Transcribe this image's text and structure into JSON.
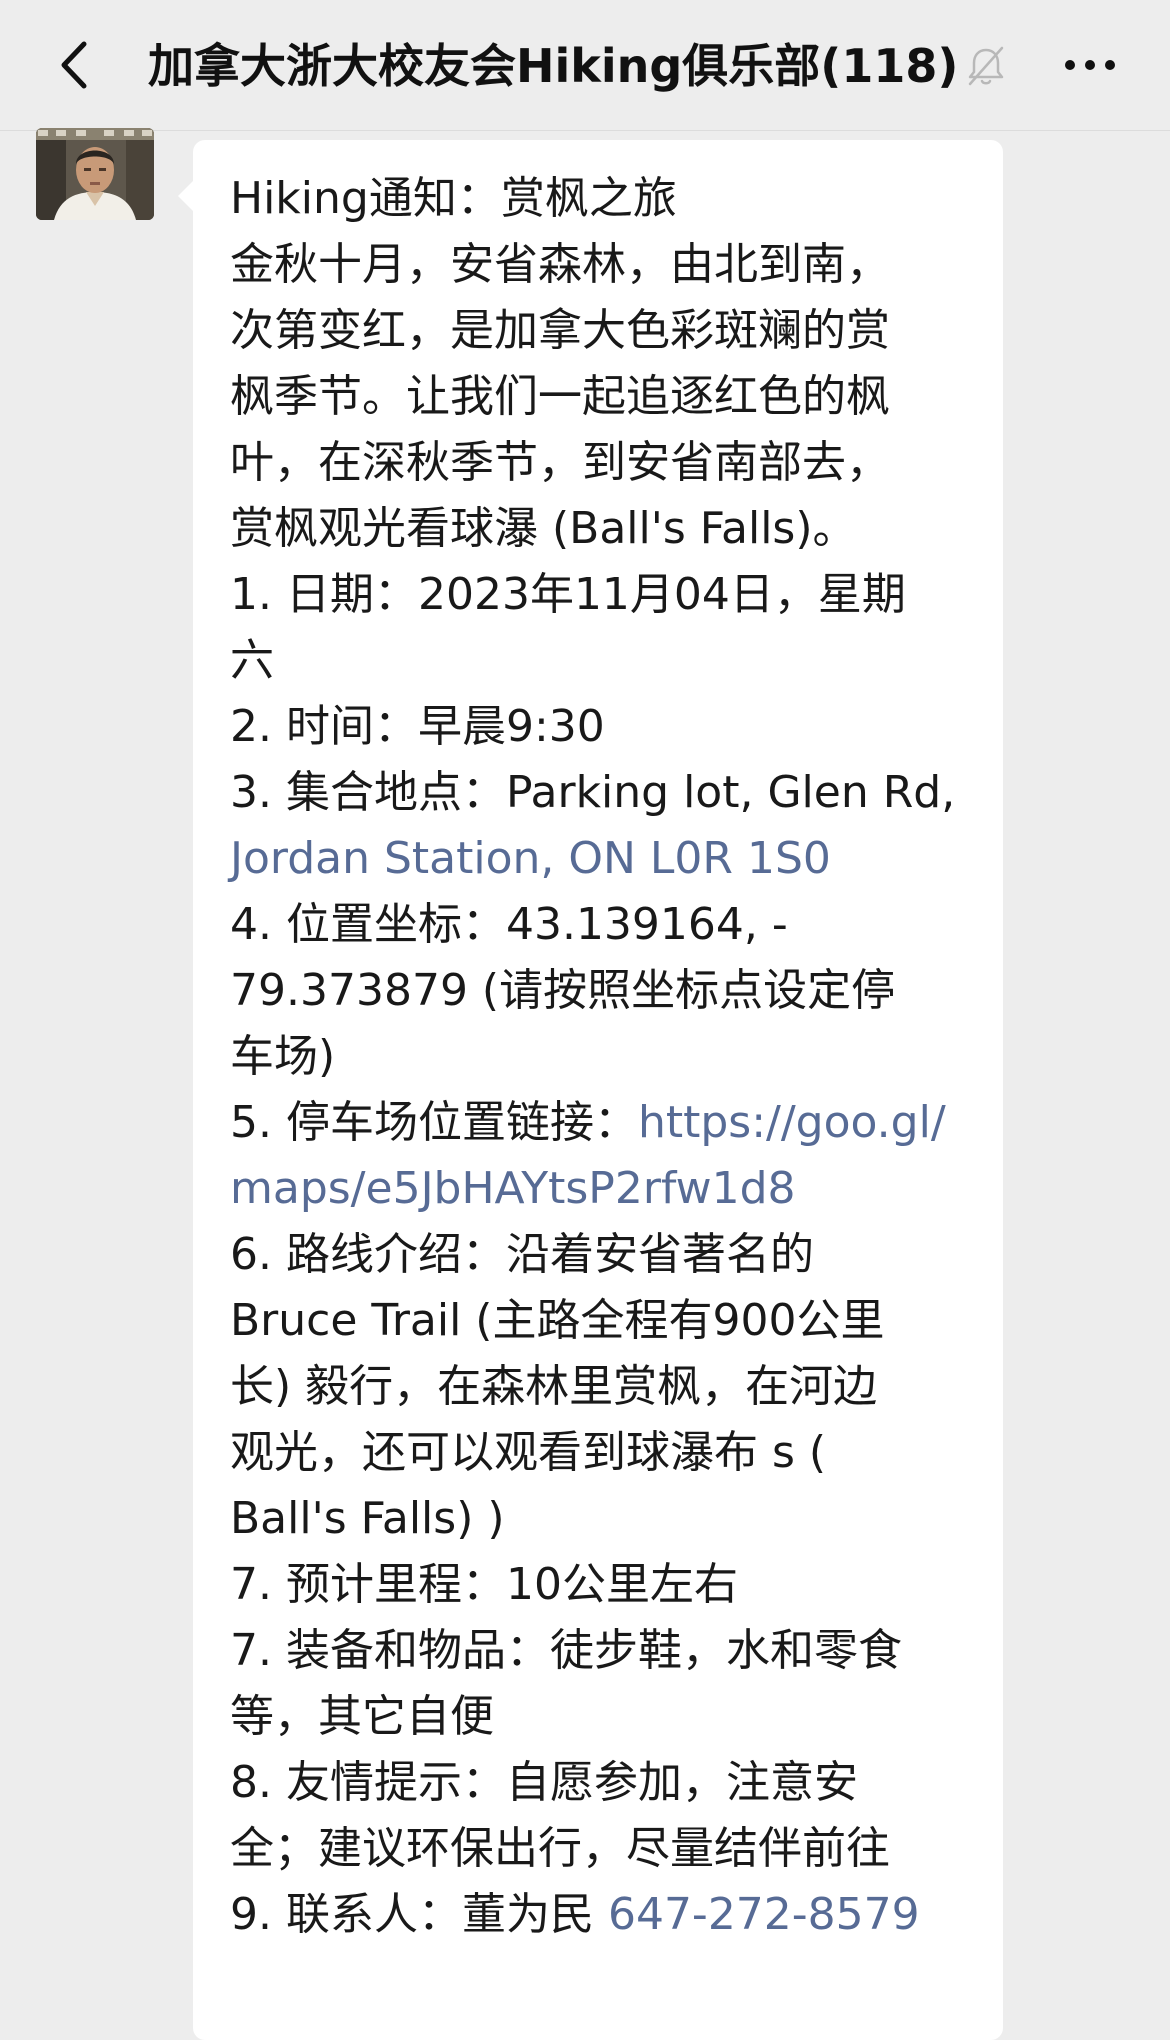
{
  "header": {
    "title": "加拿大浙大校友会Hiking俱乐部(118)",
    "back_icon": "chevron-left-icon",
    "mute_icon": "bell-off-icon",
    "more_icon": "ellipsis-icon"
  },
  "colors": {
    "background": "#ededed",
    "bubble": "#ffffff",
    "link": "#576b95",
    "text": "#191919"
  },
  "message": {
    "lines": [
      "Hiking通知：赏枫之旅",
      "金秋十月，安省森林，由北到南，",
      "次第变红，是加拿大色彩斑斓的赏",
      "枫季节。让我们一起追逐红色的枫",
      "叶，在深秋季节，到安省南部去，",
      "赏枫观光看球瀑 (Ball's Falls)。",
      "1. 日期：2023年11月04日，星期",
      "六",
      "2. 时间：早晨9:30"
    ],
    "item3_prefix": "3. 集合地点：Parking lot, Glen Rd,",
    "item3_link": " Jordan Station, ON L0R 1S0",
    "lines_mid": [
      "4. 位置坐标：43.139164, -",
      "79.373879 (请按照坐标点设定停",
      "车场)"
    ],
    "item5_prefix": "5. 停车场位置链接：",
    "item5_link_part1": "https://goo.gl/",
    "item5_link_part2": "maps/e5JbHAYtsP2rfw1d8",
    "lines_end": [
      "6. 路线介绍：沿着安省著名的",
      "Bruce Trail (主路全程有900公里",
      "长) 毅行，在森林里赏枫，在河边",
      "观光，还可以观看到球瀑布 s (",
      "Ball's Falls) )",
      "7. 预计里程：10公里左右",
      "7. 装备和物品：徒步鞋，水和零食",
      "等，其它自便",
      "8. 友情提示：自愿参加，注意安",
      "全；建议环保出行，尽量结伴前往"
    ],
    "item9_prefix": "9. 联系人：董为民 ",
    "item9_phone": "647-272-8579"
  }
}
